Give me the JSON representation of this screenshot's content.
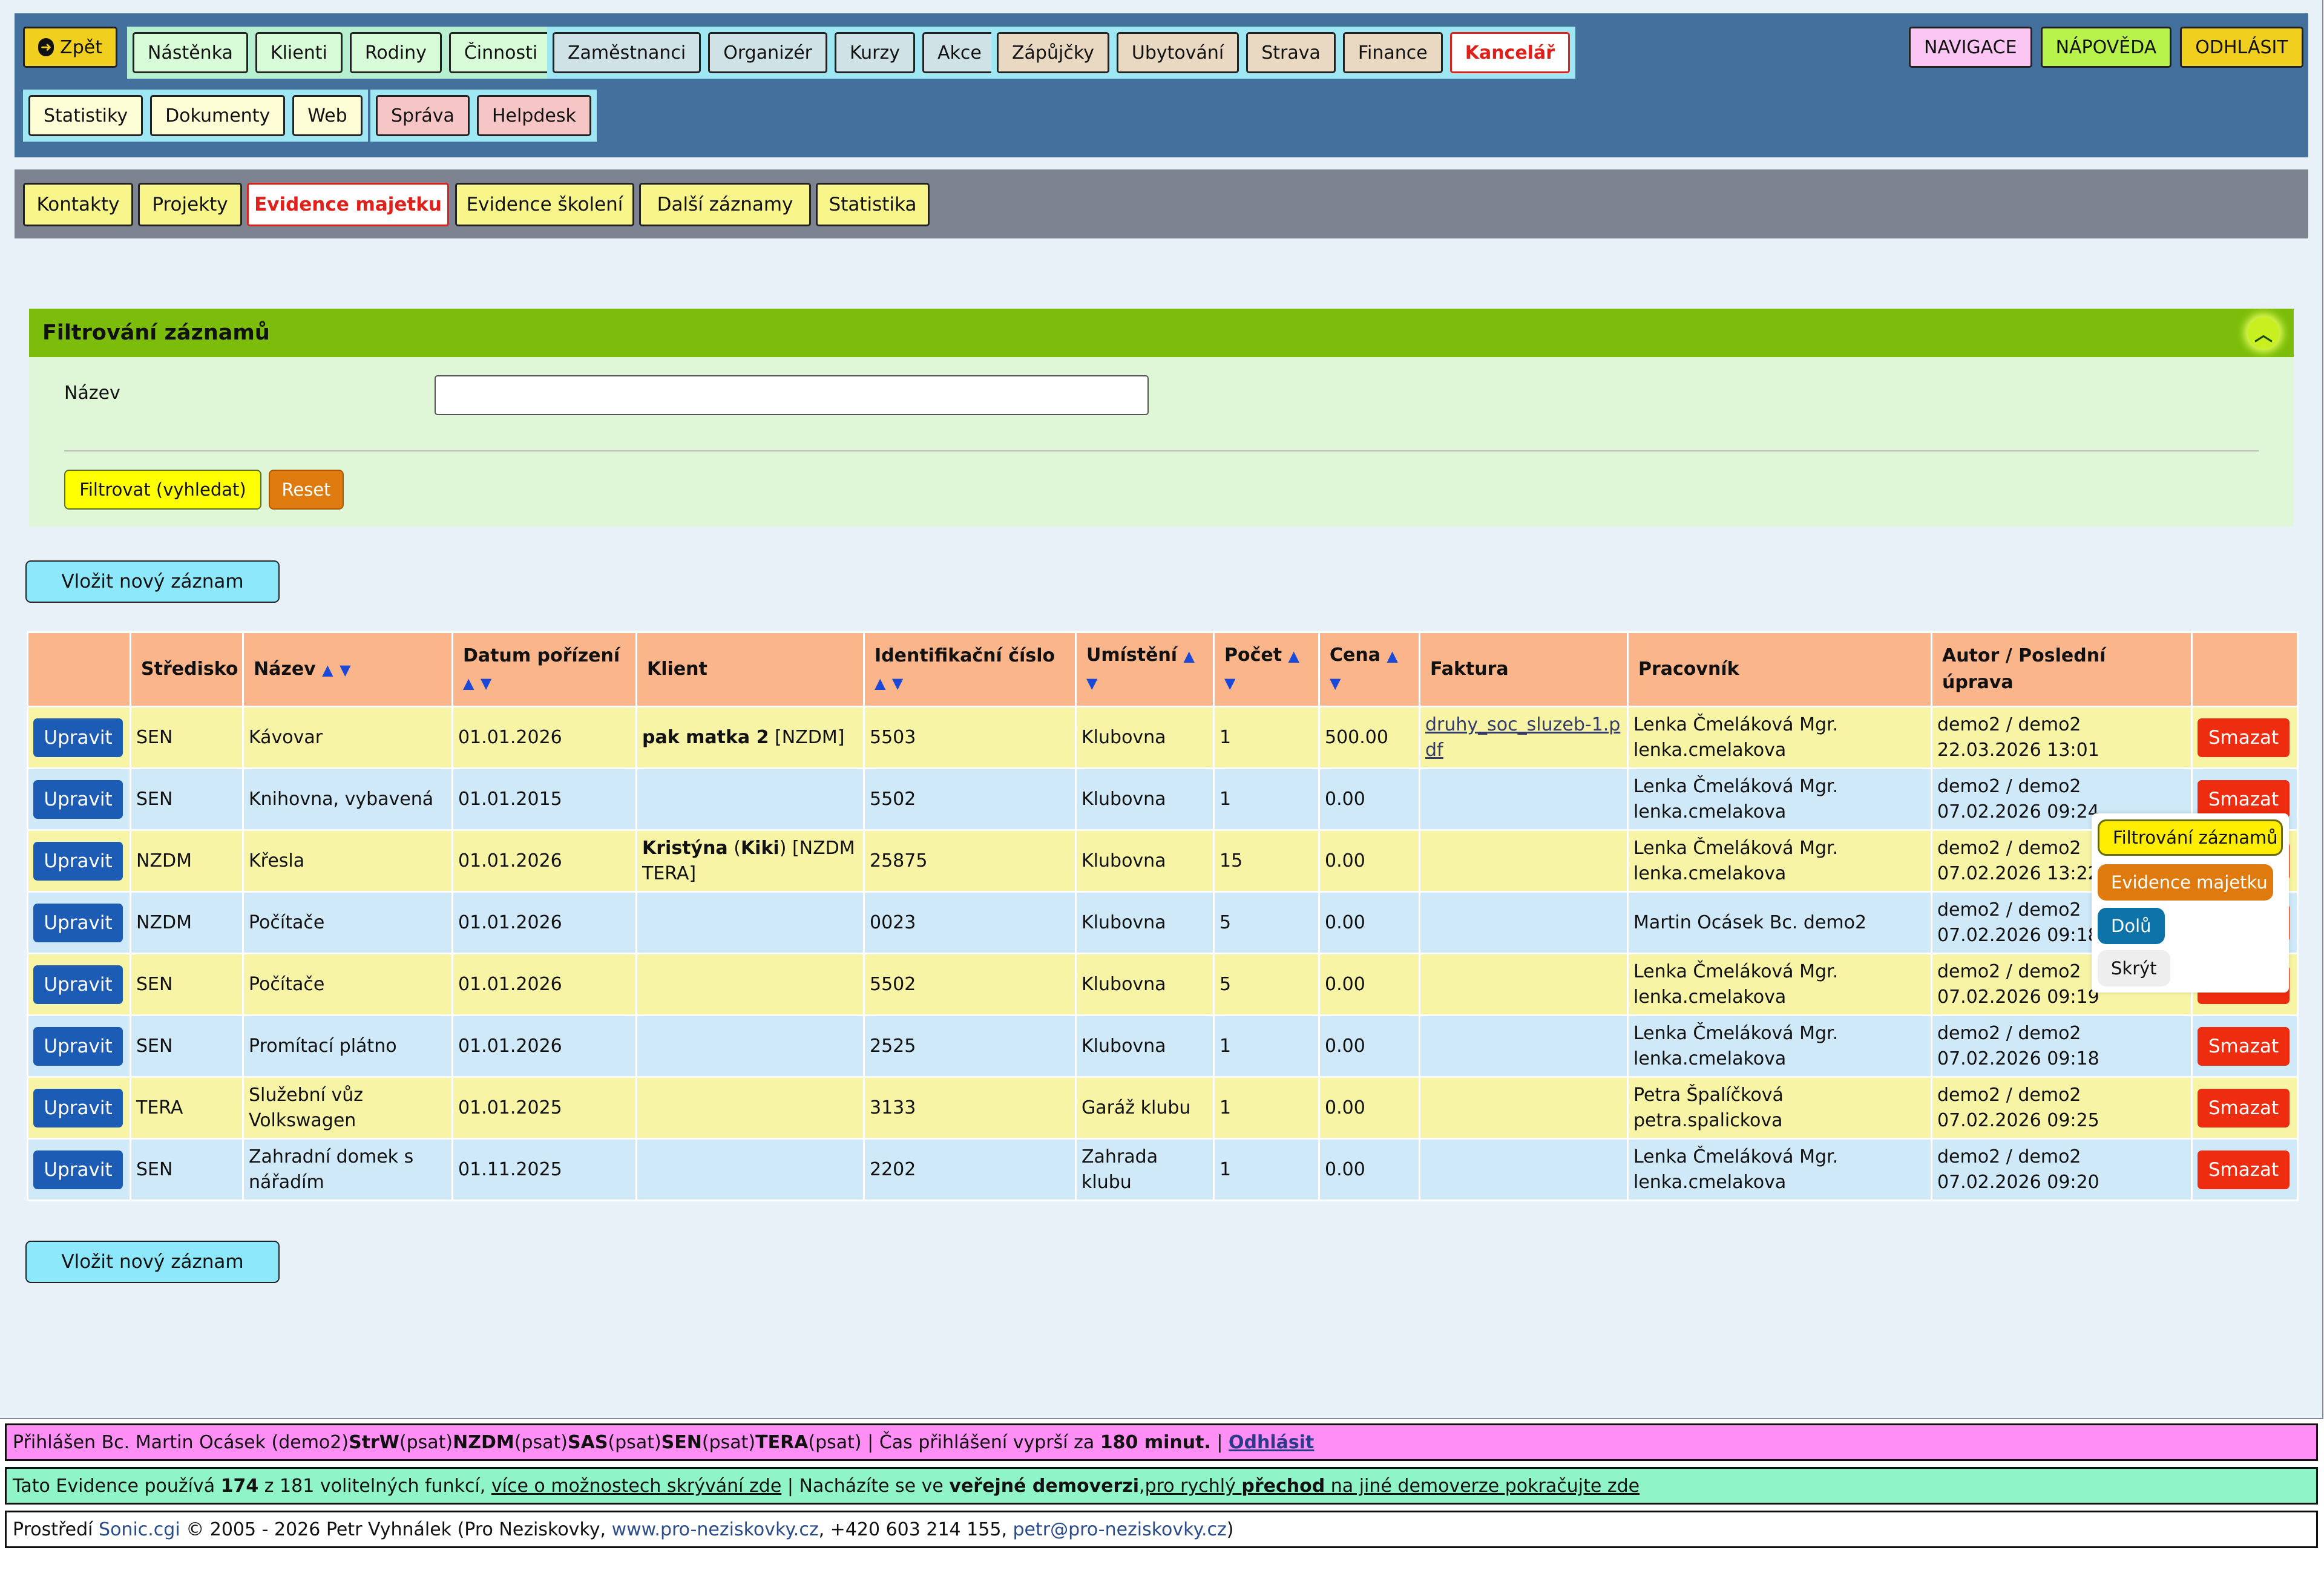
{
  "topnav": {
    "back": {
      "icon": "arrow-left-circle-icon",
      "label": "Zpět"
    },
    "group1": [
      "Nástěnka",
      "Klienti",
      "Rodiny",
      "Činnosti"
    ],
    "group2": [
      "Zaměstnanci",
      "Organizér",
      "Kurzy",
      "Akce"
    ],
    "group3": [
      "Zápůjčky",
      "Ubytování",
      "Strava",
      "Finance",
      "Kancelář"
    ],
    "group4": [
      "Statistiky",
      "Dokumenty",
      "Web"
    ],
    "group5": [
      "Správa",
      "Helpdesk"
    ],
    "right": [
      "NAVIGACE",
      "NÁPOVĚDA",
      "ODHLÁSIT"
    ]
  },
  "subnav": [
    "Kontakty",
    "Projekty",
    "Evidence majetku",
    "Evidence školení",
    "Další záznamy",
    "Statistika"
  ],
  "filter": {
    "title": "Filtrování záznamů",
    "name_label": "Název",
    "name_value": "",
    "submit": "Filtrovat (vyhledat)",
    "reset": "Reset"
  },
  "insert_label": "Vložit nový záznam",
  "table": {
    "headers": {
      "stredisko": "Středisko",
      "nazev": "Název",
      "datum": "Datum pořízení",
      "klient": "Klient",
      "id": "Identifikační číslo",
      "umisteni": "Umístění",
      "pocet": "Počet",
      "cena": "Cena",
      "faktura": "Faktura",
      "pracovnik": "Pracovník",
      "autor": "Autor / Poslední úprava"
    },
    "sort_up": "▲",
    "sort_down": "▼",
    "edit_label": "Upravit",
    "delete_label": "Smazat",
    "rows": [
      {
        "stredisko": "SEN",
        "nazev": "Kávovar",
        "datum": "01.01.2026",
        "klient_bold": "pak matka 2",
        "klient_rest": " [NZDM]",
        "id": "5503",
        "umisteni": "Klubovna",
        "pocet": "1",
        "cena": "500.00",
        "faktura": "druhy_soc_sluzeb-1.pdf",
        "pracovnik": "Lenka Čmeláková Mgr. lenka.cmelakova",
        "autor": "demo2 / demo2 22.03.2026 13:01"
      },
      {
        "stredisko": "SEN",
        "nazev": "Knihovna, vybavená",
        "datum": "01.01.2015",
        "klient_bold": "",
        "klient_rest": "",
        "id": "5502",
        "umisteni": "Klubovna",
        "pocet": "1",
        "cena": "0.00",
        "faktura": "",
        "pracovnik": "Lenka Čmeláková Mgr. lenka.cmelakova",
        "autor": "demo2 / demo2 07.02.2026 09:24"
      },
      {
        "stredisko": "NZDM",
        "nazev": "Křesla",
        "datum": "01.01.2026",
        "klient_bold": "Kristýna",
        "klient_paren": "Kiki",
        "klient_rest": "[NZDM TERA]",
        "id": "25875",
        "umisteni": "Klubovna",
        "pocet": "15",
        "cena": "0.00",
        "faktura": "",
        "pracovnik": "Lenka Čmeláková Mgr. lenka.cmelakova",
        "autor": "demo2 / demo2 07.02.2026 13:22"
      },
      {
        "stredisko": "NZDM",
        "nazev": "Počítače",
        "datum": "01.01.2026",
        "klient_bold": "",
        "klient_rest": "",
        "id": "0023",
        "umisteni": "Klubovna",
        "pocet": "5",
        "cena": "0.00",
        "faktura": "",
        "pracovnik": "Martin Ocásek Bc. demo2",
        "autor": "demo2 / demo2 07.02.2026 09:18"
      },
      {
        "stredisko": "SEN",
        "nazev": "Počítače",
        "datum": "01.01.2026",
        "klient_bold": "",
        "klient_rest": "",
        "id": "5502",
        "umisteni": "Klubovna",
        "pocet": "5",
        "cena": "0.00",
        "faktura": "",
        "pracovnik": "Lenka Čmeláková Mgr. lenka.cmelakova",
        "autor": "demo2 / demo2 07.02.2026 09:19"
      },
      {
        "stredisko": "SEN",
        "nazev": "Promítací plátno",
        "datum": "01.01.2026",
        "klient_bold": "",
        "klient_rest": "",
        "id": "2525",
        "umisteni": "Klubovna",
        "pocet": "1",
        "cena": "0.00",
        "faktura": "",
        "pracovnik": "Lenka Čmeláková Mgr. lenka.cmelakova",
        "autor": "demo2 / demo2 07.02.2026 09:18"
      },
      {
        "stredisko": "TERA",
        "nazev": "Služební vůz Volkswagen",
        "datum": "01.01.2025",
        "klient_bold": "",
        "klient_rest": "",
        "id": "3133",
        "umisteni": "Garáž klubu",
        "pocet": "1",
        "cena": "0.00",
        "faktura": "",
        "pracovnik": "Petra Špalíčková petra.spalickova",
        "autor": "demo2 / demo2 07.02.2026 09:25"
      },
      {
        "stredisko": "SEN",
        "nazev": "Zahradní domek s nářadím",
        "datum": "01.11.2025",
        "klient_bold": "",
        "klient_rest": "",
        "id": "2202",
        "umisteni": "Zahrada klubu",
        "pocet": "1",
        "cena": "0.00",
        "faktura": "",
        "pracovnik": "Lenka Čmeláková Mgr. lenka.cmelakova",
        "autor": "demo2 / demo2 07.02.2026 09:20"
      }
    ]
  },
  "float_panel": {
    "filter": "Filtrování záznamů",
    "evidence": "Evidence majetku",
    "down": "Dolů",
    "hide": "Skrýt"
  },
  "status": {
    "login_prefix": "Přihlášen Bc. Martin Ocásek (demo2) ",
    "roles": [
      {
        "name": "StrW",
        "perm": " (psat) "
      },
      {
        "name": "NZDM",
        "perm": " (psat) "
      },
      {
        "name": "SAS",
        "perm": " (psat) "
      },
      {
        "name": "SEN",
        "perm": " (psat) "
      },
      {
        "name": "TERA",
        "perm": " (psat) "
      }
    ],
    "sep": " | ",
    "expire_text": "Čas přihlášení vyprší za ",
    "expire_value": "180 minut.",
    "logout": "Odhlásit",
    "evidence_prefix": "Tato Evidence používá ",
    "evidence_count": "174",
    "evidence_of": " z 181 volitelných funkcí, ",
    "evidence_link": "více o možnostech skrývání zde",
    "demo_prefix": "Nacházíte se ve ",
    "demo_bold": "veřejné demoverzi",
    "demo_link1": "pro rychlý ",
    "demo_link_bold": "přechod",
    "demo_link2": " na jiné demoverze pokračujte zde",
    "footer_prefix": "Prostředí ",
    "footer_sonic": "Sonic.cgi",
    "footer_mid": " © 2005 - 2026 Petr Vyhnálek (Pro Neziskovky, ",
    "footer_web": "www.pro-neziskovky.cz",
    "footer_phone": ", +420 603 214 155, ",
    "footer_mail": "petr@pro-neziskovky.cz",
    "footer_end": ")"
  },
  "colors": {
    "topnav_bg": "#44709e",
    "subnav_bg": "#7d8390",
    "filter_head": "#7bbd0a",
    "table_head": "#fbb58a",
    "row_odd": "#f8f4a6",
    "row_even": "#cfe9f8",
    "status_login": "#ff8ef5",
    "status_evidence": "#8ff5c8"
  }
}
